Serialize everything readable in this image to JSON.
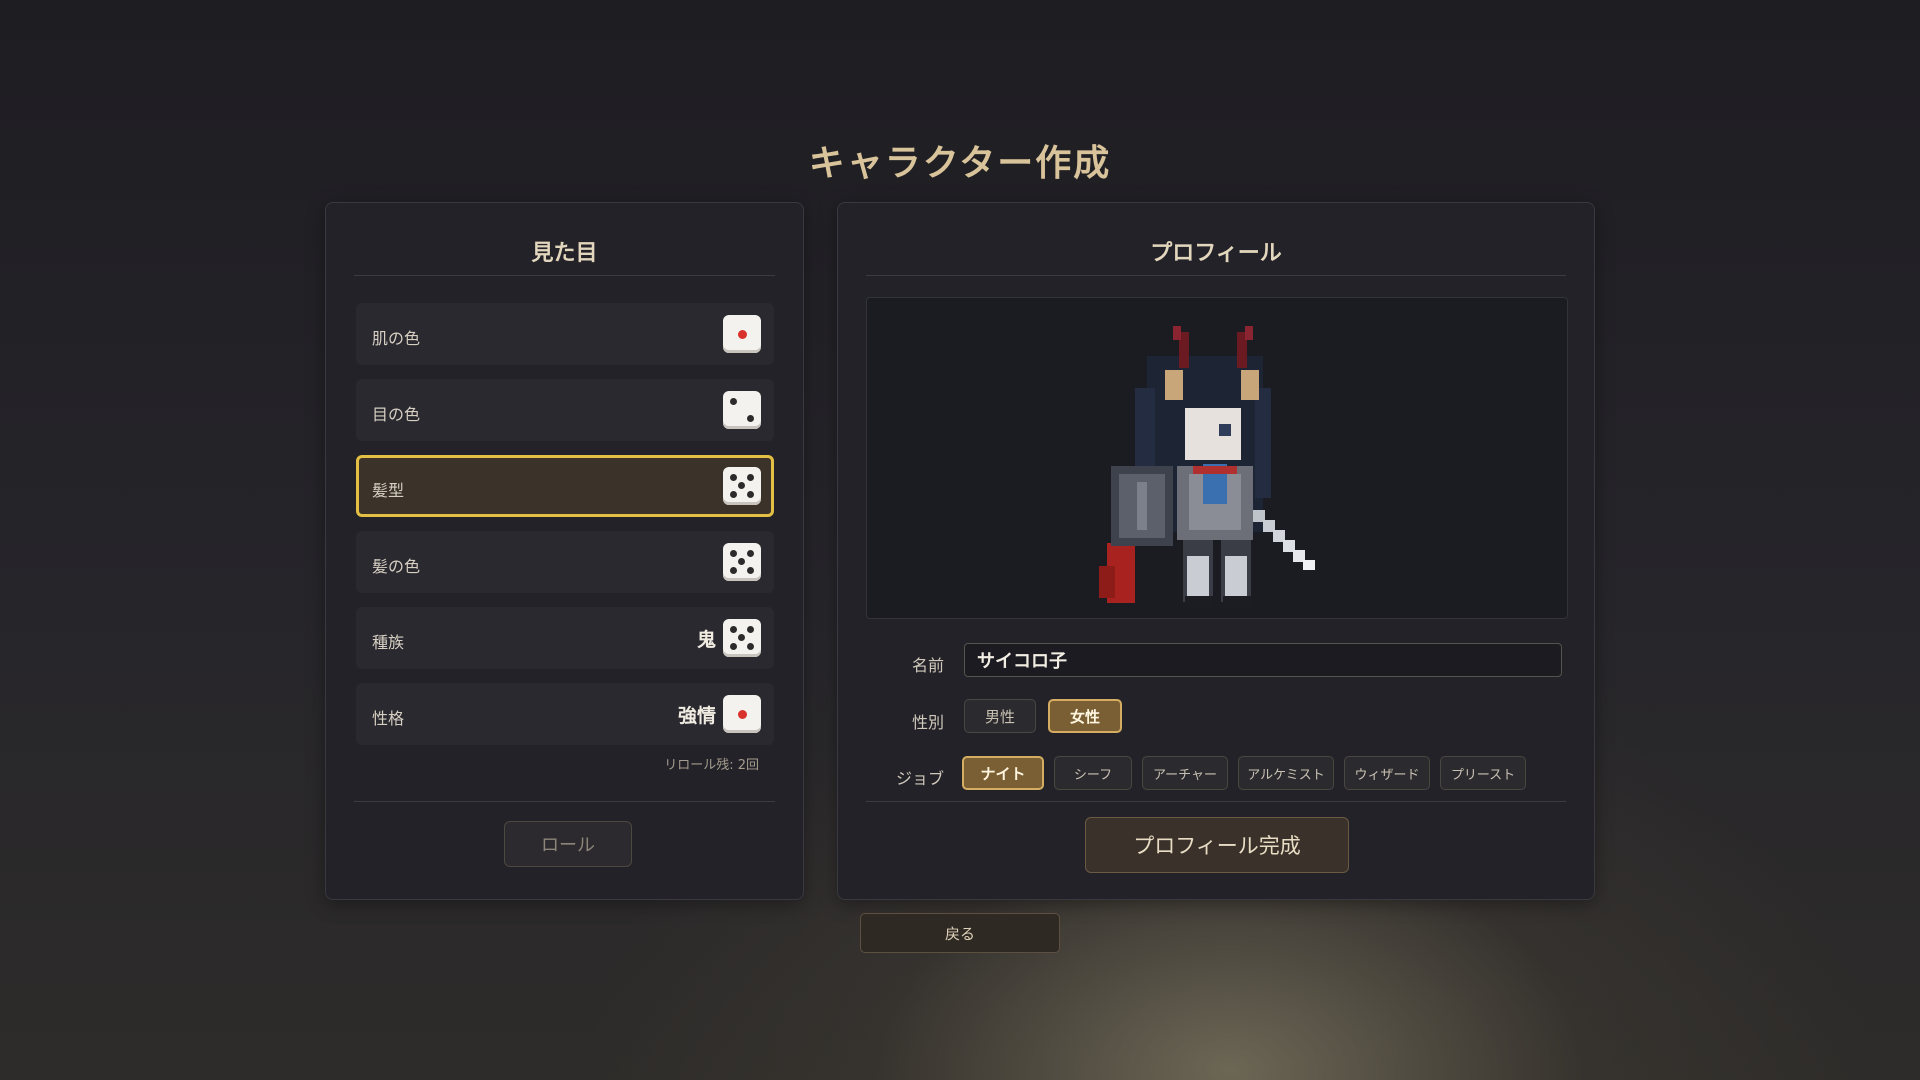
{
  "title": "キャラクター作成",
  "appearance": {
    "header": "見た目",
    "rows": [
      {
        "label": "肌の色",
        "value": "",
        "die": 1
      },
      {
        "label": "目の色",
        "value": "",
        "die": 2
      },
      {
        "label": "髪型",
        "value": "",
        "die": 5,
        "selected": true
      },
      {
        "label": "髪の色",
        "value": "",
        "die": 5
      },
      {
        "label": "種族",
        "value": "鬼",
        "die": 5
      },
      {
        "label": "性格",
        "value": "強情",
        "die": 1
      }
    ],
    "reroll_text": "リロール残: 2回",
    "roll_button": "ロール"
  },
  "profile": {
    "header": "プロフィール",
    "name_label": "名前",
    "name_value": "サイコロ子",
    "gender_label": "性別",
    "genders": [
      "男性",
      "女性"
    ],
    "gender_selected": "女性",
    "job_label": "ジョブ",
    "jobs": [
      "ナイト",
      "シーフ",
      "アーチャー",
      "アルケミスト",
      "ウィザード",
      "プリースト"
    ],
    "job_selected": "ナイト",
    "complete_button": "プロフィール完成"
  },
  "back_button": "戻る",
  "colors": {
    "accent_gold": "#d4ad62",
    "selected_border": "#e3c043",
    "title_color": "#d8c39a"
  }
}
